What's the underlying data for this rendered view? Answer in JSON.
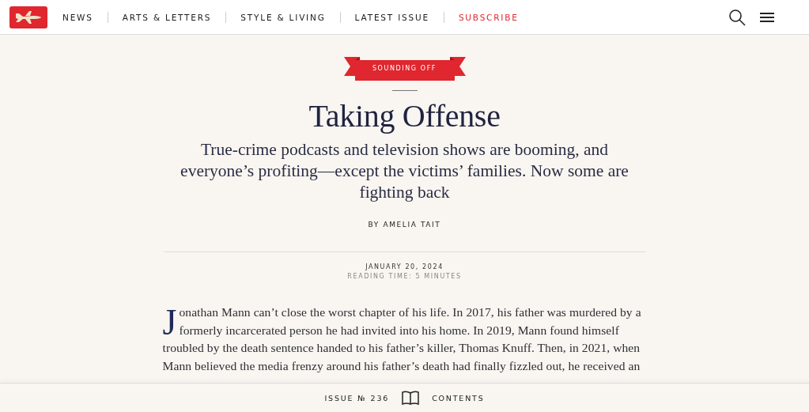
{
  "nav": {
    "items": [
      {
        "label": "NEWS",
        "kind": "link"
      },
      {
        "label": "ARTS & LETTERS",
        "kind": "link"
      },
      {
        "label": "STYLE & LIVING",
        "kind": "link"
      },
      {
        "label": "LATEST ISSUE",
        "kind": "link"
      },
      {
        "label": "SUBSCRIBE",
        "kind": "accent"
      }
    ]
  },
  "article": {
    "section": "SOUNDING OFF",
    "title": "Taking Offense",
    "dek": "True-crime podcasts and television shows are booming, and everyone’s profiting—except the victims’ families. Now some are fighting back",
    "byline": "BY AMELIA TAIT",
    "date": "JANUARY 20, 2024",
    "reading_time": "READING TIME: 5 MINUTES",
    "drop_cap": "J",
    "body": "onathan Mann can’t close the worst chapter of his life. In 2017, his father was murdered by a formerly incarcerated person he had invited into his home. In 2019, Mann found himself troubled by the death sentence handed to his father’s killer, Thomas Knuff. Then, in 2021, when Mann believed the media frenzy around his father’s death had finally fizzled out, he received an"
  },
  "footer": {
    "issue": "ISSUE № 236",
    "contents": "CONTENTS"
  }
}
